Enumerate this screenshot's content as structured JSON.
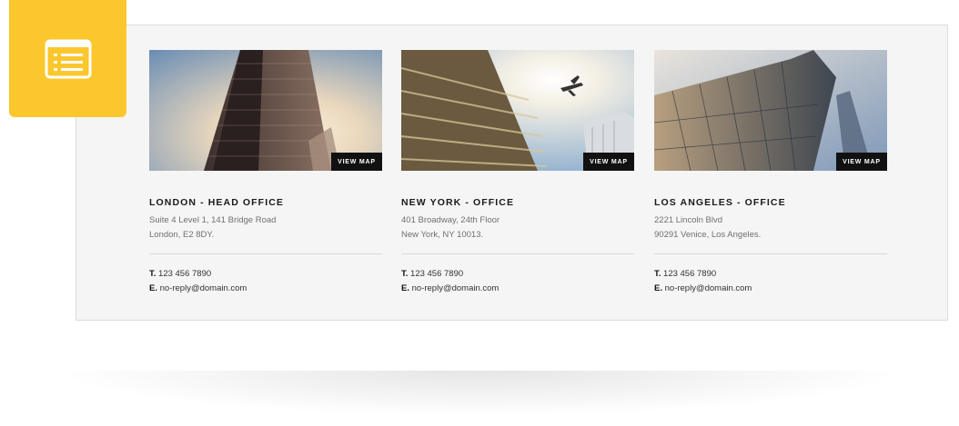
{
  "offices": [
    {
      "title": "LONDON - HEAD OFFICE",
      "address_line1": "Suite 4 Level 1, 141 Bridge Road",
      "address_line2": "London, E2 8DY.",
      "phone_label": "T.",
      "phone": "123 456 7890",
      "email_label": "E.",
      "email": "no-reply@domain.com",
      "button_label": "VIEW MAP"
    },
    {
      "title": "NEW YORK - OFFICE",
      "address_line1": "401 Broadway, 24th Floor",
      "address_line2": "New York, NY 10013.",
      "phone_label": "T.",
      "phone": "123 456 7890",
      "email_label": "E.",
      "email": "no-reply@domain.com",
      "button_label": "VIEW MAP"
    },
    {
      "title": "LOS ANGELES - OFFICE",
      "address_line1": "2221 Lincoln Blvd",
      "address_line2": "90291 Venice, Los Angeles.",
      "phone_label": "T.",
      "phone": "123 456 7890",
      "email_label": "E.",
      "email": "no-reply@domain.com",
      "button_label": "VIEW MAP"
    }
  ],
  "badge": {
    "icon": "list-icon",
    "color": "#fbc72c"
  }
}
